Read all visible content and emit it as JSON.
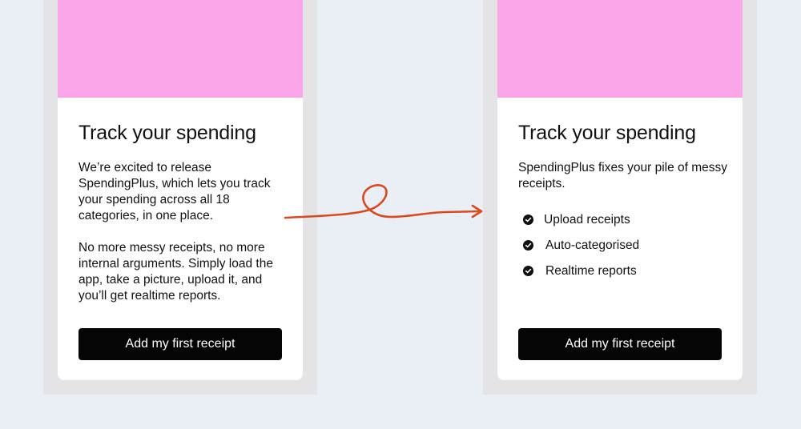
{
  "colors": {
    "page_background": "#eaeff6",
    "frame": "#e4e4e6",
    "hero": "#fba6e8",
    "button": "#050505",
    "arrow": "#d94b1f"
  },
  "icons": {
    "check": "check-circle-icon",
    "arrow": "squiggle-arrow-icon"
  },
  "left_card": {
    "title": "Track your spending",
    "paragraph_1": "We’re excited to release SpendingPlus, which lets you track your spending across all 18 categories, in one place.",
    "paragraph_2": "No more messy receipts, no more internal arguments. Simply load the app, take a picture, upload it, and you’ll get realtime reports.",
    "button_label": "Add my first receipt"
  },
  "right_card": {
    "title": "Track your spending",
    "paragraph": "SpendingPlus fixes your pile of messy receipts.",
    "features": [
      "Upload receipts",
      "Auto-categorised",
      "Realtime reports"
    ],
    "button_label": "Add my first receipt"
  }
}
